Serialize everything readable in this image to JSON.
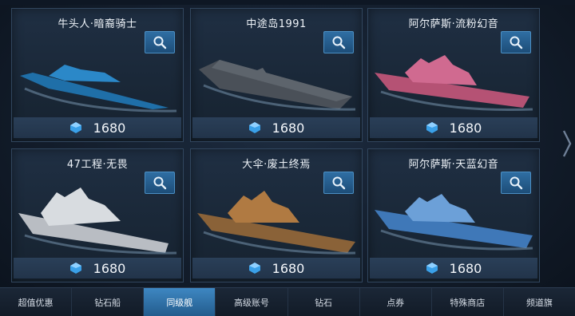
{
  "cards": [
    {
      "title": "牛头人·暗裔骑士",
      "price": "1680",
      "ship_color": "#1f6fa8",
      "deck_color": "#2b88c8"
    },
    {
      "title": "中途岛1991",
      "price": "1680",
      "ship_color": "#4a5058",
      "deck_color": "#5d646c"
    },
    {
      "title": "阿尔萨斯·流粉幻音",
      "price": "1680",
      "ship_color": "#b55274",
      "deck_color": "#d06a90"
    },
    {
      "title": "47工程·无畏",
      "price": "1680",
      "ship_color": "#b9bdc3",
      "deck_color": "#d8dce0"
    },
    {
      "title": "大伞·废土终焉",
      "price": "1680",
      "ship_color": "#8a6238",
      "deck_color": "#b07a42"
    },
    {
      "title": "阿尔萨斯·天蓝幻音",
      "price": "1680",
      "ship_color": "#3f78b8",
      "deck_color": "#6ca0d8"
    }
  ],
  "tabs": [
    {
      "label": "超值优惠",
      "active": false
    },
    {
      "label": "钻石船",
      "active": false
    },
    {
      "label": "同级舰",
      "active": true
    },
    {
      "label": "高级账号",
      "active": false
    },
    {
      "label": "钻石",
      "active": false
    },
    {
      "label": "点券",
      "active": false
    },
    {
      "label": "特殊商店",
      "active": false
    },
    {
      "label": "频道旗",
      "active": false
    }
  ],
  "icons": {
    "search": "magnifier-icon",
    "currency": "diamond-gem-icon",
    "next": "chevron-right-icon"
  },
  "colors": {
    "accent": "#3e87c2",
    "panel": "#1f2f43",
    "gem": "#3aa0e8"
  }
}
